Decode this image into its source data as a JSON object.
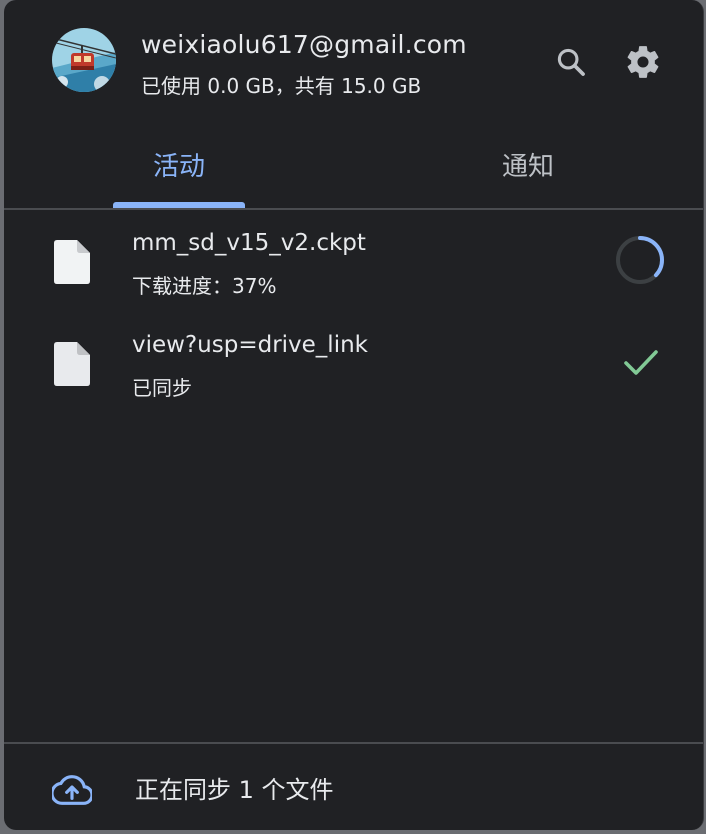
{
  "account": {
    "email": "weixiaolu617@gmail.com",
    "storage_usage": "已使用 0.0 GB，共有 15.0 GB"
  },
  "header": {
    "search_icon": "search-icon",
    "settings_icon": "gear-icon"
  },
  "tabs": [
    {
      "label": "活动",
      "selected": true
    },
    {
      "label": "通知",
      "selected": false
    }
  ],
  "files": [
    {
      "name": "mm_sd_v15_v2.ckpt",
      "status": "下载进度：37%",
      "progress": 0.37,
      "status_icon": "progress-spinner-icon"
    },
    {
      "name": "view?usp=drive_link",
      "status": "已同步",
      "status_icon": "checkmark-icon"
    }
  ],
  "footer": {
    "icon": "cloud-upload-icon",
    "text": "正在同步 1 个文件"
  },
  "colors": {
    "background": "#202124",
    "accent": "#8ab4f8",
    "success": "#81c995",
    "text": "#e8eaed"
  }
}
